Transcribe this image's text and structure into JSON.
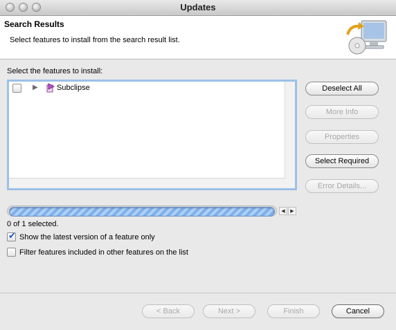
{
  "window": {
    "title": "Updates"
  },
  "header": {
    "title": "Search Results",
    "description": "Select features to install from the search result list.",
    "icon": "computer-update-icon"
  },
  "features": {
    "label": "Select the features to install:",
    "items": [
      {
        "label": "Subclipse",
        "checked": false,
        "expanded": false,
        "icon": "feature-icon"
      }
    ]
  },
  "side_buttons": {
    "deselect_all": "Deselect All",
    "more_info": "More Info",
    "properties": "Properties",
    "select_required": "Select Required",
    "error_details": "Error Details..."
  },
  "status": {
    "selected_text": "0 of 1 selected."
  },
  "options": {
    "latest_version": {
      "label": "Show the latest version of a feature only",
      "checked": true
    },
    "filter_included": {
      "label": "Filter features included in other features on the list",
      "checked": false
    }
  },
  "footer": {
    "back": "< Back",
    "next": "Next >",
    "finish": "Finish",
    "cancel": "Cancel"
  }
}
